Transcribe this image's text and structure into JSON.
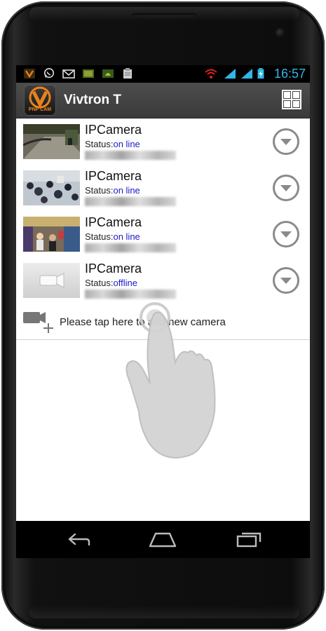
{
  "status_bar": {
    "time": "16:57",
    "icons_left": [
      "app-logo-icon",
      "whatsapp-icon",
      "mail-icon",
      "image-icon",
      "android-icon",
      "clipboard-icon"
    ],
    "icons_right": [
      "wifi-icon",
      "signal-icon",
      "signal-icon",
      "battery-charging-icon"
    ]
  },
  "app_bar": {
    "title": "Vivtron T",
    "logo_text": "PNP CAM",
    "right_icon": "grid-view-icon"
  },
  "cameras": [
    {
      "name": "IPCamera",
      "status_label": "Status:",
      "status": "on line",
      "thumb": "road-scene"
    },
    {
      "name": "IPCamera",
      "status_label": "Status:",
      "status": "on line",
      "thumb": "crowd-scene"
    },
    {
      "name": "IPCamera",
      "status_label": "Status:",
      "status": "on line",
      "thumb": "shop-scene"
    },
    {
      "name": "IPCamera",
      "status_label": "Status:",
      "status": "offline",
      "thumb": "camera-placeholder"
    }
  ],
  "add_camera": {
    "label": "Please tap here to add new camera",
    "icon": "add-camera-icon"
  },
  "colors": {
    "status_link": "#1a1acc",
    "time": "#33b5e5",
    "app_bar": "#404040",
    "logo_orange": "#e8821e"
  },
  "nav_bar": {
    "buttons": [
      "back-icon",
      "home-icon",
      "recents-icon"
    ]
  }
}
